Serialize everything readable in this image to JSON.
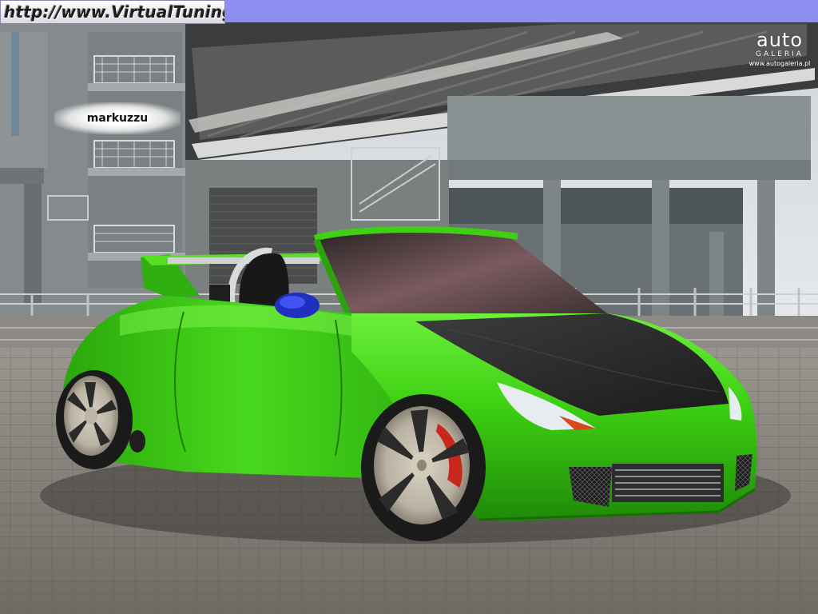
{
  "header": {
    "site_url": "http://www.VirtualTuning.IT"
  },
  "watermark": {
    "brand_top": "auto",
    "brand_bottom": "GALERIA",
    "url": "www.autogaleria.pl"
  },
  "author": {
    "name": "markuzzu"
  },
  "colors": {
    "header_bar": "#8c8ff0",
    "car_body": "#3fcf14",
    "hood": "#303030",
    "mirror": "#2233cc",
    "pavement": "#8a8680",
    "building": "#7f8486"
  }
}
